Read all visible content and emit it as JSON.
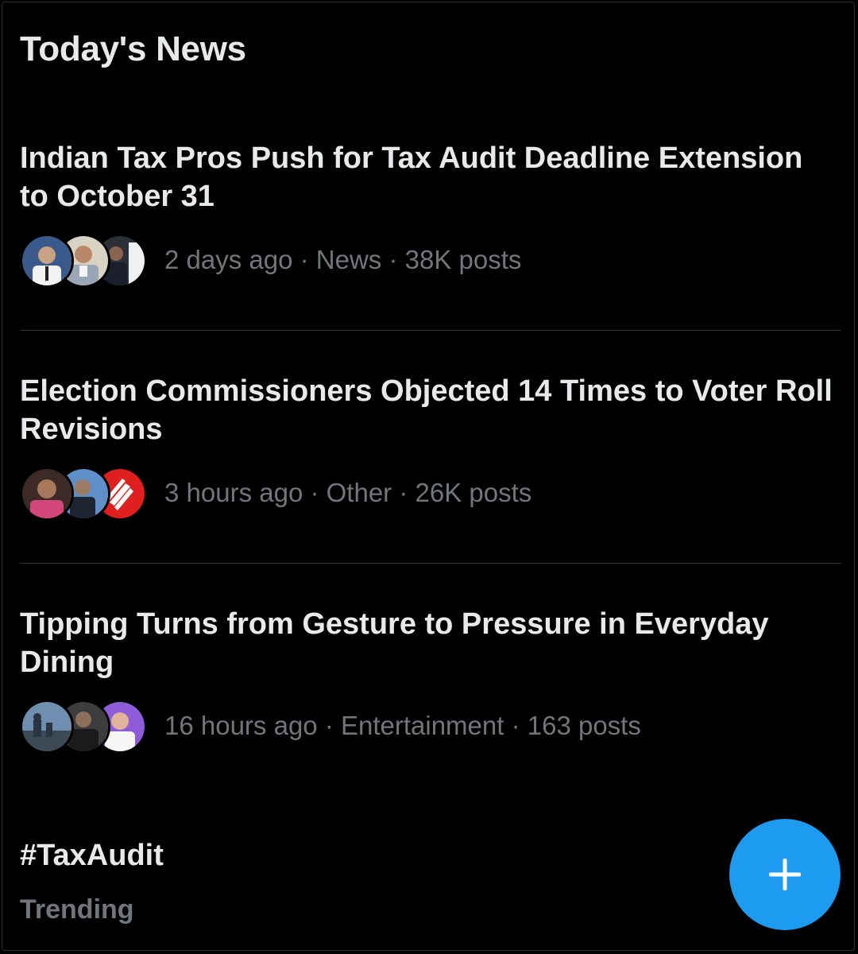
{
  "section": {
    "title": "Today's News"
  },
  "stories": [
    {
      "headline": "Indian Tax Pros Push for Tax Audit Deadline Extension to October 31",
      "meta": "2 days ago · News · 38K posts",
      "avatars": [
        "person-avatar",
        "person-avatar",
        "person-avatar"
      ]
    },
    {
      "headline": "Election Commissioners Objected 14 Times to Voter Roll Revisions",
      "meta": "3 hours ago · Other · 26K posts",
      "avatars": [
        "person-avatar",
        "person-avatar",
        "news-logo-avatar"
      ]
    },
    {
      "headline": "Tipping Turns from Gesture to Pressure in Everyday Dining",
      "meta": "16 hours ago · Entertainment · 163 posts",
      "avatars": [
        "scene-avatar",
        "person-avatar",
        "person-avatar"
      ]
    }
  ],
  "trend": {
    "tag": "#TaxAudit",
    "label": "Trending"
  },
  "fab": {
    "icon": "plus-icon"
  },
  "colors": {
    "background": "#000000",
    "primary_text": "#e7e9ea",
    "secondary_text": "#71767b",
    "divider": "#2f3336",
    "accent": "#1d9bf0"
  }
}
